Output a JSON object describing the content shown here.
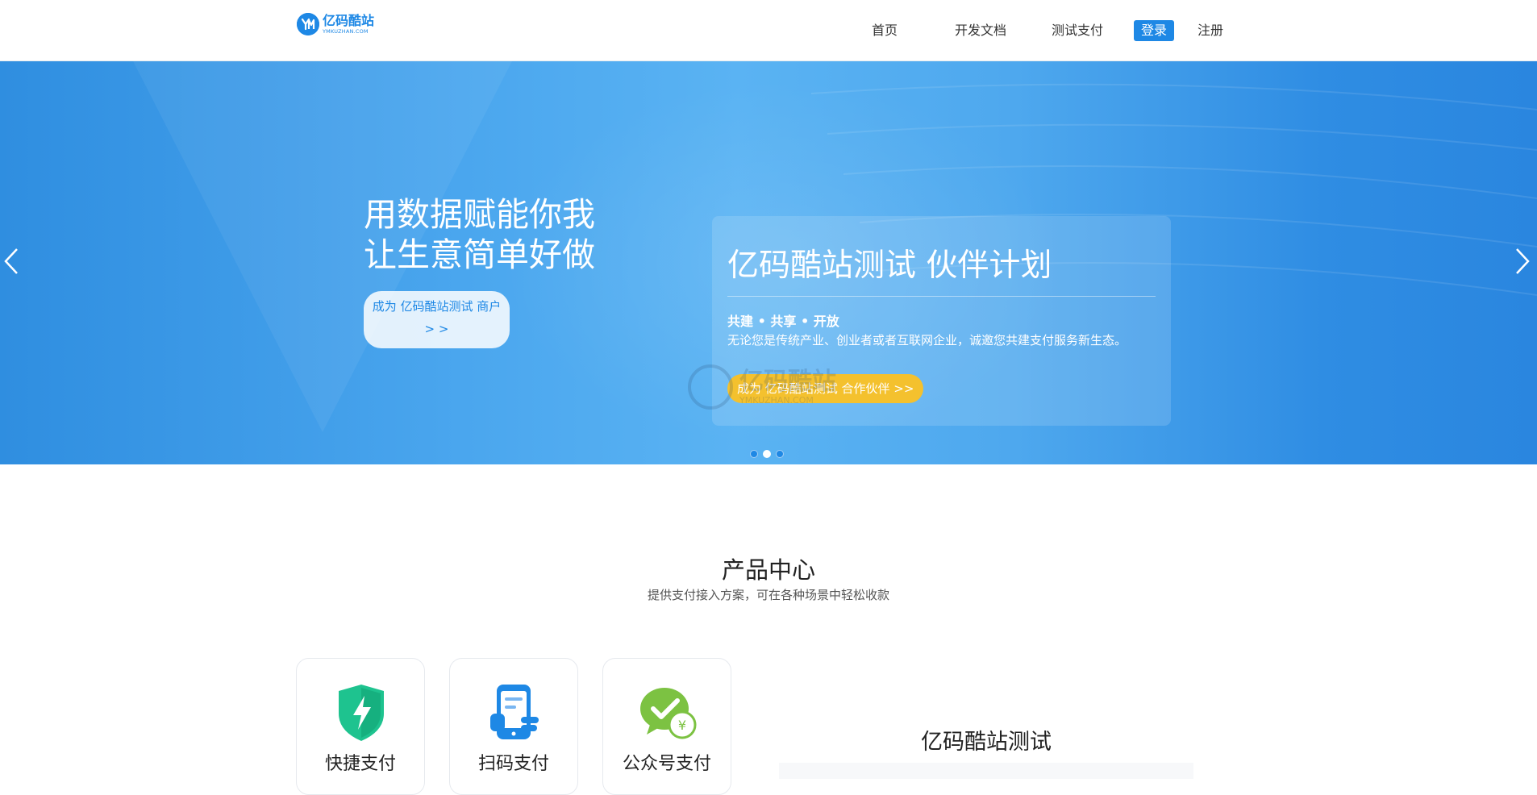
{
  "header": {
    "logo": {
      "name": "亿码酷站",
      "domain": "YMKUZHAN.COM",
      "icon": "ymk-logo-icon"
    },
    "nav": {
      "home": "首页",
      "docs": "开发文档",
      "test_pay": "测试支付",
      "login": "登录",
      "register": "注册"
    }
  },
  "banner": {
    "hero_line1": "用数据赋能你我",
    "hero_line2": "让生意简单好做",
    "hero_button_line1": "成为 亿码酷站测试 商户",
    "hero_button_line2": "> >",
    "card": {
      "title": "亿码酷站测试 伙伴计划",
      "tagline": "共建 • 共享 • 开放",
      "description": "无论您是传统产业、创业者或者互联网企业，诚邀您共建支付服务新生态。",
      "button": "成为 亿码酷站测试 合作伙伴 >>"
    },
    "watermark": {
      "name": "亿码酷站",
      "domain": "YMKUZHAN.COM"
    },
    "prev_icon": "chevron-left-icon",
    "next_icon": "chevron-right-icon",
    "slide_count": 3,
    "active_slide": 2
  },
  "products": {
    "title": "产品中心",
    "subtitle": "提供支付接入方案，可在各种场景中轻松收款",
    "items": [
      {
        "label": "快捷支付",
        "icon": "shield-lightning-icon"
      },
      {
        "label": "扫码支付",
        "icon": "phone-scan-icon"
      },
      {
        "label": "公众号支付",
        "icon": "wechat-pay-icon"
      }
    ],
    "right_title": "亿码酷站测试"
  },
  "colors": {
    "brand_blue": "#1e88e5",
    "accent_yellow": "#f4c12e",
    "shield_green": "#1ec38f",
    "wechat_green": "#7cc242"
  }
}
